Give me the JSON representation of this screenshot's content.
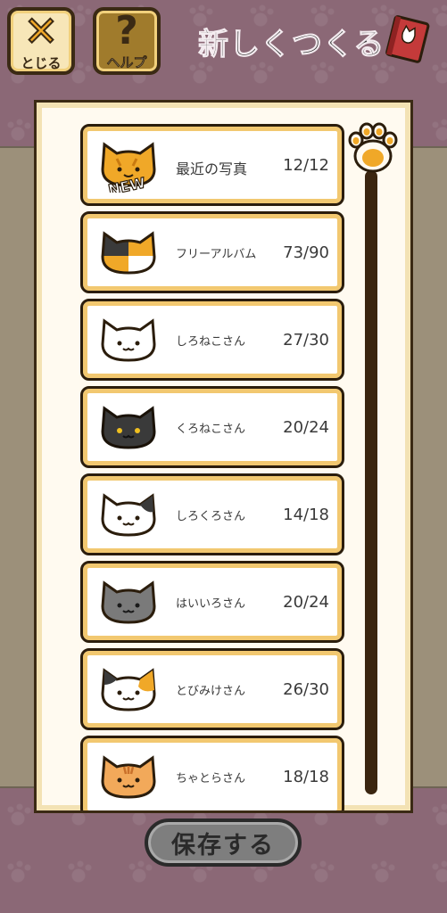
{
  "header": {
    "close_label": "とじる",
    "help_label": "ヘルプ",
    "title": "新しくつくる"
  },
  "albums": [
    {
      "name": "最近の写真",
      "count": "12/12",
      "icon": "new-cat-icon",
      "badge": "NEW"
    },
    {
      "name": "フリーアルバム",
      "count": "73/90",
      "icon": "calico-split-cat-icon"
    },
    {
      "name": "しろねこさん",
      "count": "27/30",
      "icon": "white-cat-icon"
    },
    {
      "name": "くろねこさん",
      "count": "20/24",
      "icon": "black-cat-icon"
    },
    {
      "name": "しろくろさん",
      "count": "14/18",
      "icon": "white-black-cat-icon"
    },
    {
      "name": "はいいろさん",
      "count": "20/24",
      "icon": "gray-cat-icon"
    },
    {
      "name": "とびみけさん",
      "count": "26/30",
      "icon": "calico-cat-icon"
    },
    {
      "name": "ちゃとらさん",
      "count": "18/18",
      "icon": "orange-tabby-cat-icon"
    }
  ],
  "footer": {
    "save_label": "保存する"
  },
  "colors": {
    "background": "#8b6876",
    "card_border": "#f2c870",
    "orange": "#f0a828",
    "dark": "#3b2a14"
  }
}
